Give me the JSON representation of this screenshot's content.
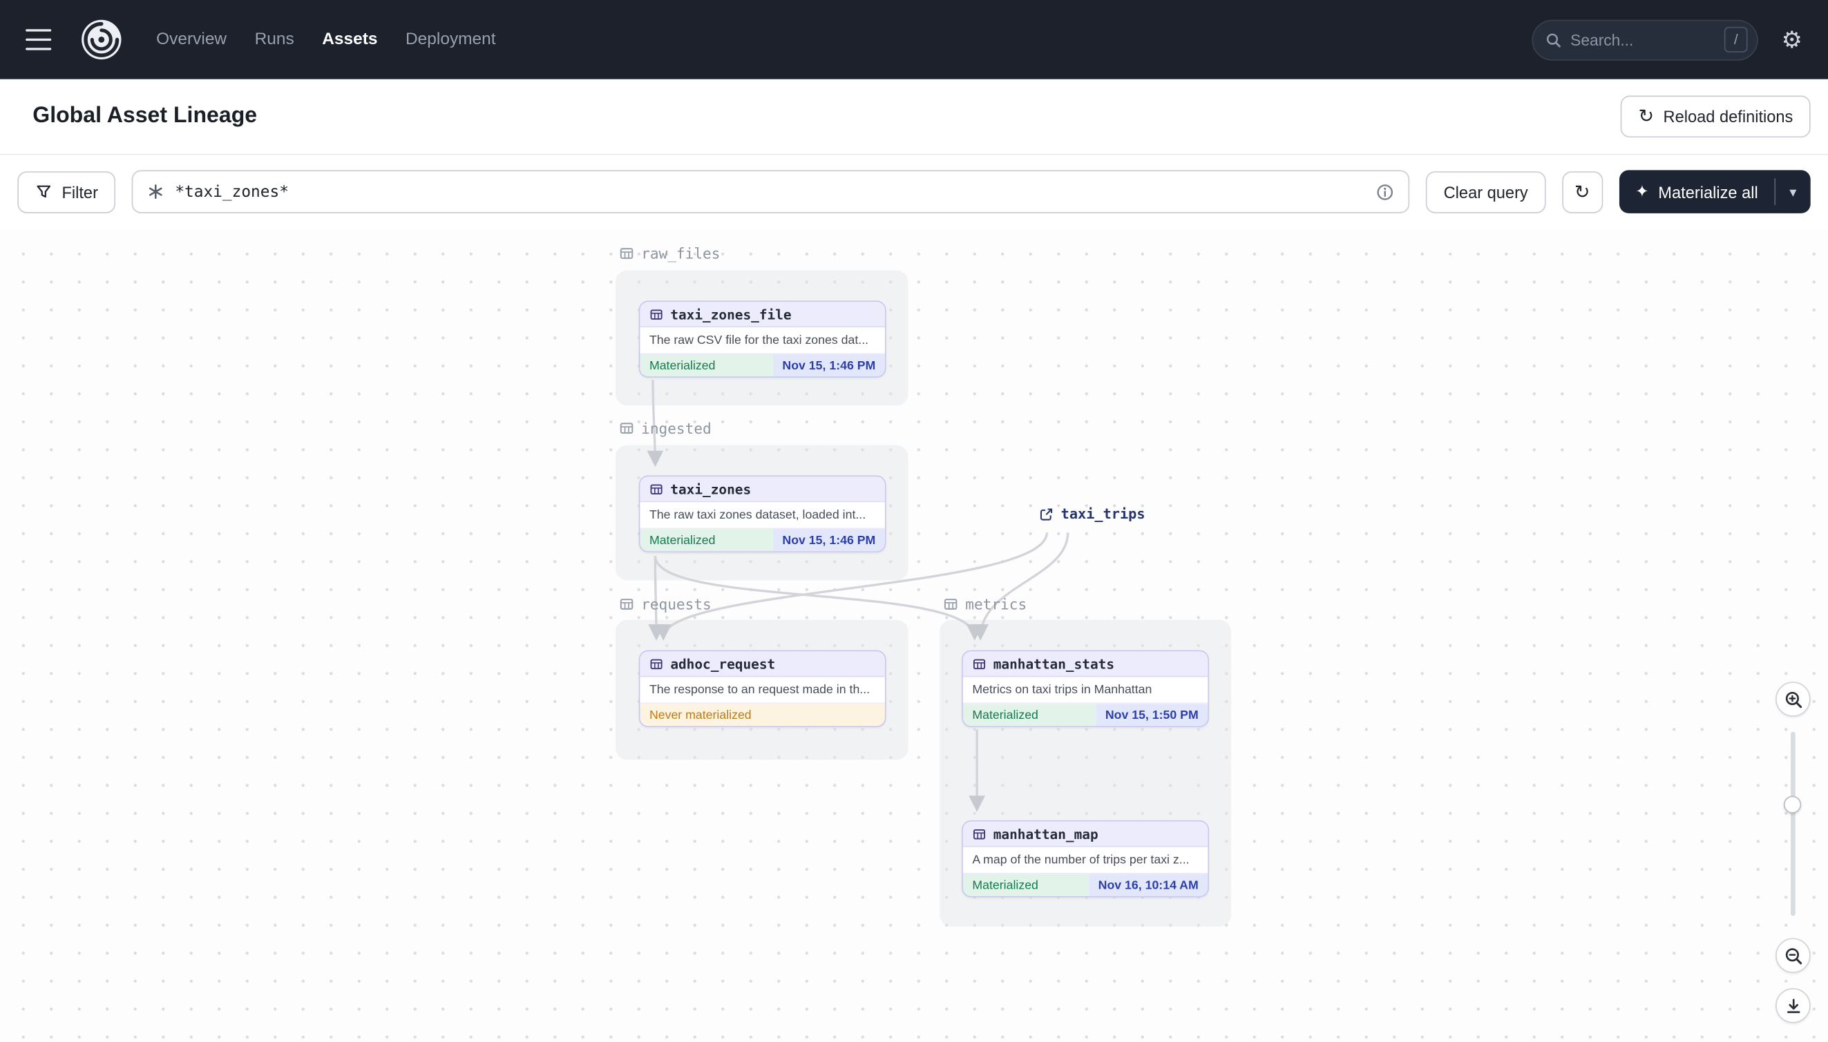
{
  "icons": {
    "gear": "⚙",
    "refresh": "↻",
    "sparkle": "✦",
    "caret_down": "▾"
  },
  "colors": {
    "navbar_bg": "#1c212b",
    "accent_lavender": "#c9c5f1",
    "node_header_bg": "#edecfc",
    "materialized_green": "#18794e",
    "timestamp_navy": "#2c3fa8",
    "never_materialized_orange": "#bf7a16",
    "edge_gray": "#d2d4da",
    "primary_button_bg": "#1d2433"
  },
  "navbar": {
    "links": [
      {
        "label": "Overview",
        "active": false
      },
      {
        "label": "Runs",
        "active": false
      },
      {
        "label": "Assets",
        "active": true
      },
      {
        "label": "Deployment",
        "active": false
      }
    ],
    "search": {
      "placeholder": "Search...",
      "shortcut": "/"
    }
  },
  "header": {
    "title": "Global Asset Lineage",
    "reload_button": "Reload definitions"
  },
  "toolbar": {
    "filter_button": "Filter",
    "query": {
      "value": "*taxi_zones*"
    },
    "clear_button": "Clear query",
    "materialize_button": "Materialize all"
  },
  "graph": {
    "groups": [
      {
        "name": "raw_files"
      },
      {
        "name": "ingested"
      },
      {
        "name": "requests"
      },
      {
        "name": "metrics"
      }
    ],
    "nodes": [
      {
        "name": "taxi_zones_file",
        "description": "The raw CSV file for the taxi zones dat...",
        "status": "Materialized",
        "timestamp": "Nov 15, 1:46 PM"
      },
      {
        "name": "taxi_zones",
        "description": "The raw taxi zones dataset, loaded int...",
        "status": "Materialized",
        "timestamp": "Nov 15, 1:46 PM"
      },
      {
        "name": "adhoc_request",
        "description": "The response to an request made in th...",
        "status": "Never materialized"
      },
      {
        "name": "manhattan_stats",
        "description": "Metrics on taxi trips in Manhattan",
        "status": "Materialized",
        "timestamp": "Nov 15, 1:50 PM"
      },
      {
        "name": "manhattan_map",
        "description": "A map of the number of trips per taxi z...",
        "status": "Materialized",
        "timestamp": "Nov 16, 10:14 AM"
      }
    ],
    "external_asset": {
      "name": "taxi_trips"
    }
  }
}
